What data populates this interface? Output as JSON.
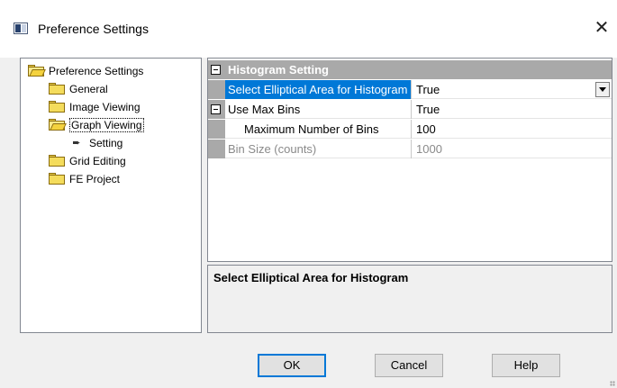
{
  "window": {
    "title": "Preference Settings",
    "close_glyph": "✕"
  },
  "tree": {
    "root": "Preference Settings",
    "items": [
      {
        "label": "General",
        "icon": "folder-icon"
      },
      {
        "label": "Image Viewing",
        "icon": "folder-icon"
      },
      {
        "label": "Graph Viewing",
        "icon": "folder-open-icon",
        "selected": true
      },
      {
        "label": "Setting",
        "icon": "arrow-right-icon"
      },
      {
        "label": "Grid Editing",
        "icon": "folder-icon"
      },
      {
        "label": "FE Project",
        "icon": "folder-icon"
      }
    ]
  },
  "grid": {
    "category": "Histogram Setting",
    "rows": [
      {
        "label": "Select Elliptical Area for Histogram",
        "value": "True"
      },
      {
        "label": "Use Max Bins",
        "value": "True"
      },
      {
        "label": "Maximum Number of Bins",
        "value": "100"
      },
      {
        "label": "Bin Size (counts)",
        "value": "1000"
      }
    ]
  },
  "description": {
    "title": "Select Elliptical Area for Histogram"
  },
  "buttons": {
    "ok": "OK",
    "cancel": "Cancel",
    "help": "Help"
  },
  "colors": {
    "selection": "#0078d7",
    "category": "#a9a9a9",
    "disabled_text": "#8a8a8a"
  }
}
